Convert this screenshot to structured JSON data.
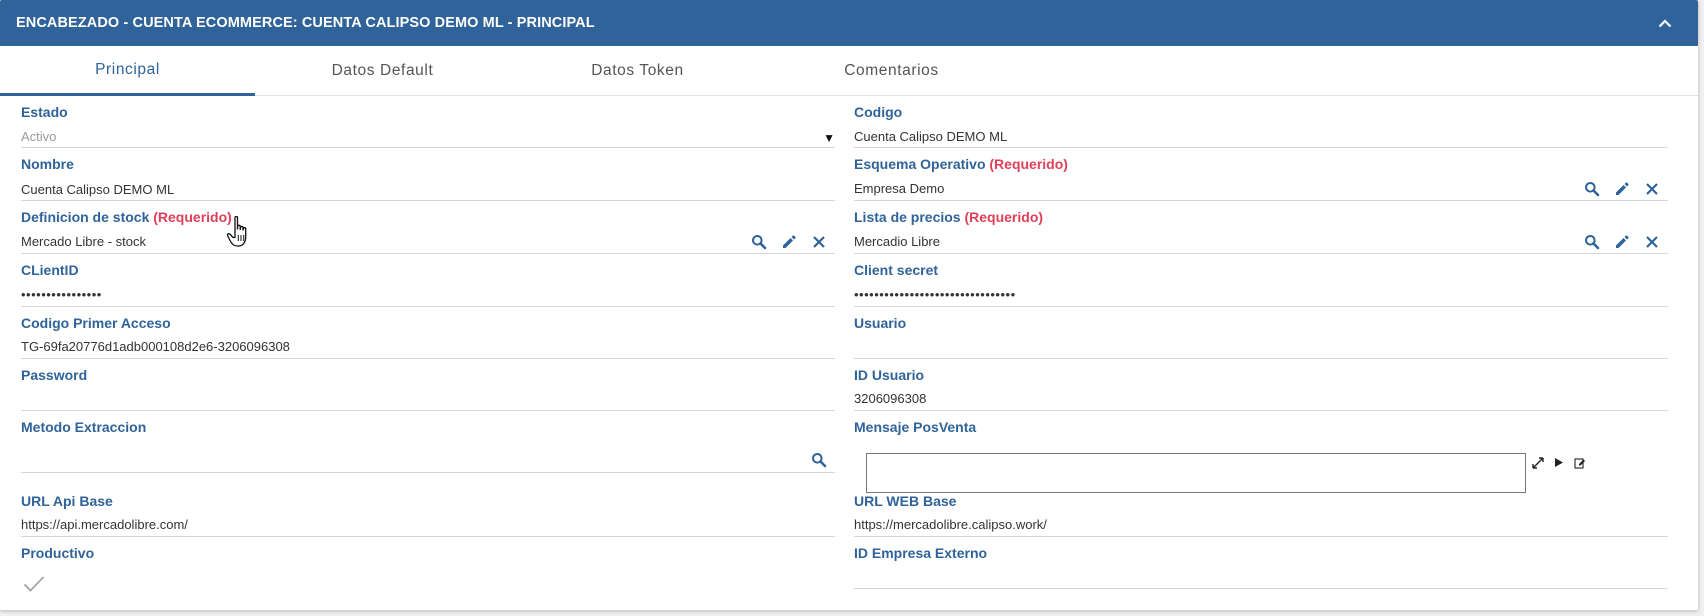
{
  "header": {
    "title": "ENCABEZADO - CUENTA ECOMMERCE: CUENTA CALIPSO DEMO ML - PRINCIPAL",
    "collapse_icon": "chevron-up-icon"
  },
  "tabs": [
    {
      "label": "Principal",
      "active": true
    },
    {
      "label": "Datos Default",
      "active": false
    },
    {
      "label": "Datos Token",
      "active": false
    },
    {
      "label": "Comentarios",
      "active": false
    }
  ],
  "colors": {
    "header_bg": "#2f6399",
    "label": "#2f6399",
    "required": "#e0405a"
  },
  "required_text": "(Requerido)",
  "left": {
    "estado": {
      "label": "Estado",
      "value": "Activo"
    },
    "nombre": {
      "label": "Nombre",
      "value": "Cuenta Calipso DEMO ML"
    },
    "definicion_stock": {
      "label": "Definicion de stock",
      "value": "Mercado Libre - stock"
    },
    "client_id": {
      "label": "CLientID",
      "value": "••••••••••••••••"
    },
    "codigo_primer_acceso": {
      "label": "Codigo Primer Acceso",
      "value": "TG-69fa20776d1adb000108d2e6-3206096308"
    },
    "password": {
      "label": "Password",
      "value": ""
    },
    "metodo_extraccion": {
      "label": "Metodo Extraccion",
      "value": ""
    },
    "url_api_base": {
      "label": "URL Api Base",
      "value": "https://api.mercadolibre.com/"
    },
    "productivo": {
      "label": "Productivo",
      "checked": true
    }
  },
  "right": {
    "codigo": {
      "label": "Codigo",
      "value": "Cuenta Calipso DEMO ML"
    },
    "esquema_operativo": {
      "label": "Esquema Operativo",
      "value": "Empresa Demo"
    },
    "lista_precios": {
      "label": "Lista de precios",
      "value": "Mercadio Libre"
    },
    "client_secret": {
      "label": "Client secret",
      "value": "••••••••••••••••••••••••••••••••"
    },
    "usuario": {
      "label": "Usuario",
      "value": ""
    },
    "id_usuario": {
      "label": "ID Usuario",
      "value": "3206096308"
    },
    "mensaje_posventa": {
      "label": "Mensaje PosVenta",
      "value": ""
    },
    "url_web_base": {
      "label": "URL WEB Base",
      "value": "https://mercadolibre.calipso.work/"
    },
    "id_empresa_externo": {
      "label": "ID Empresa Externo",
      "value": ""
    }
  }
}
